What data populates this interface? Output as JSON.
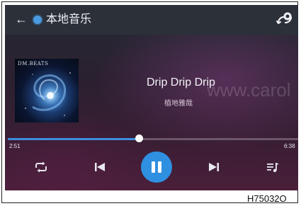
{
  "header": {
    "back_icon": "arrow-left-icon",
    "source_icon": "local-music-dot-icon",
    "title": "本地音乐",
    "cast_icon": "cast-icon"
  },
  "album": {
    "label": "DM.BEATS"
  },
  "track": {
    "title": "Drip Drip Drip",
    "artist": "植地雅哉"
  },
  "watermark": "www.carol",
  "progress": {
    "elapsed": "2:51",
    "total": "6:38",
    "fraction": 0.45
  },
  "controls": {
    "repeat_icon": "repeat-icon",
    "prev_icon": "skip-previous-icon",
    "play_state": "pause-icon",
    "next_icon": "skip-next-icon",
    "queue_icon": "playlist-icon"
  },
  "colors": {
    "accent": "#2f8fe0",
    "header_bg": "#2b3039"
  },
  "caption": "H75032O"
}
